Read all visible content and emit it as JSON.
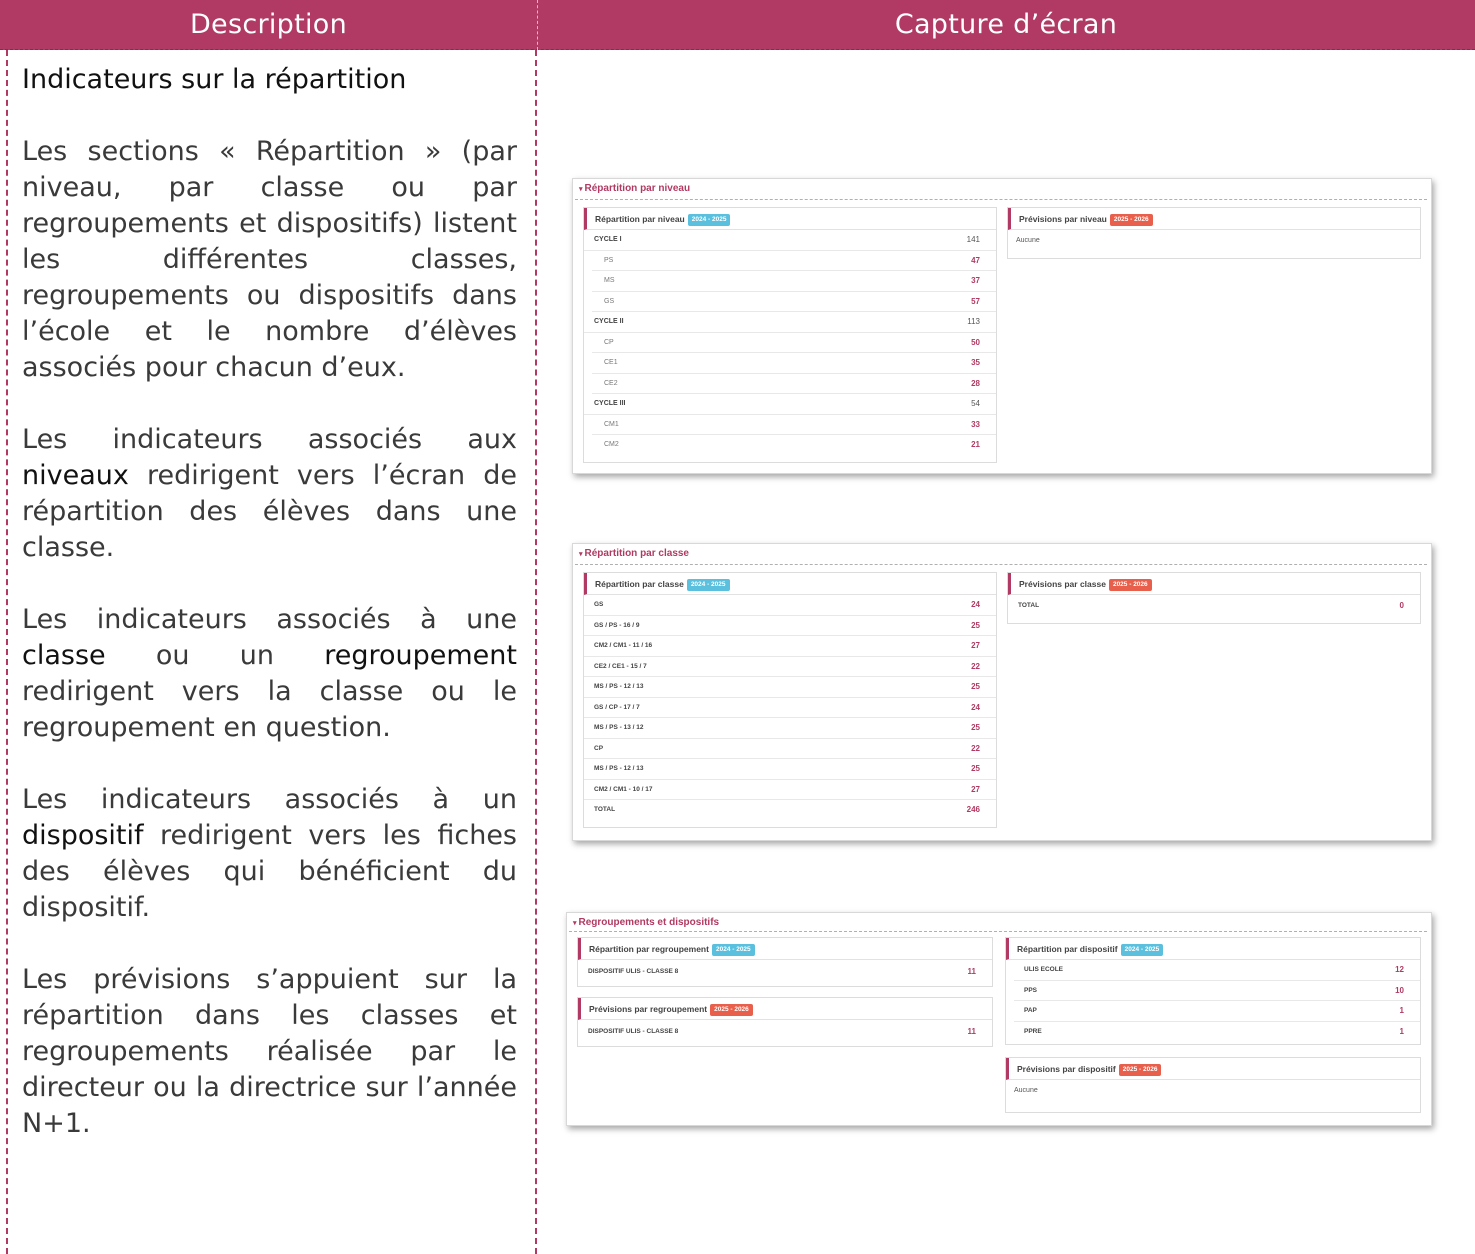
{
  "header": {
    "col_description": "Description",
    "col_capture": "Capture d’écran"
  },
  "description": {
    "title": "Indicateurs sur la répartition",
    "p1": "Les sections « Répartition » (par niveau, par classe ou par regroupements et dispositifs) listent les différentes classes, regroupements ou dispositifs dans l’école et le nombre d’élèves associés pour chacun d’eux.",
    "p2_a": "Les indicateurs associés aux ",
    "p2_kw": "niveaux",
    "p2_b": " redirigent vers l’écran de répartition des élèves dans une classe.",
    "p3_a": "Les indicateurs associés à une ",
    "p3_kw1": "classe",
    "p3_mid": " ou un ",
    "p3_kw2": "regroupement",
    "p3_b": " redirigent vers la classe ou le regroupement en question.",
    "p4_a": "Les indicateurs associés à un ",
    "p4_kw": "dispositif",
    "p4_b": " redirigent vers les fiches des élèves qui bénéficient du dispositif.",
    "p5": "Les prévisions s’appuient sur la répartition dans les classes et regroupements réalisée par le directeur ou la directrice sur l’année N+1."
  },
  "screens": {
    "niveau": {
      "section_title": "Répartition par niveau",
      "left_title": "Répartition par niveau",
      "left_badge": "2024 - 2025",
      "rows": [
        {
          "label": "CYCLE I",
          "value": "141",
          "kind": "cyc"
        },
        {
          "label": "PS",
          "value": "47",
          "kind": "sub"
        },
        {
          "label": "MS",
          "value": "37",
          "kind": "sub"
        },
        {
          "label": "GS",
          "value": "57",
          "kind": "sub"
        },
        {
          "label": "CYCLE II",
          "value": "113",
          "kind": "cyc"
        },
        {
          "label": "CP",
          "value": "50",
          "kind": "sub"
        },
        {
          "label": "CE1",
          "value": "35",
          "kind": "sub"
        },
        {
          "label": "CE2",
          "value": "28",
          "kind": "sub"
        },
        {
          "label": "CYCLE III",
          "value": "54",
          "kind": "cyc"
        },
        {
          "label": "CM1",
          "value": "33",
          "kind": "sub"
        },
        {
          "label": "CM2",
          "value": "21",
          "kind": "sub"
        }
      ],
      "right_title": "Prévisions par niveau",
      "right_badge": "2025 - 2026",
      "right_empty": "Aucune"
    },
    "classe": {
      "section_title": "Répartition par classe",
      "left_title": "Répartition par classe",
      "left_badge": "2024 - 2025",
      "rows": [
        {
          "label": "GS",
          "value": "24"
        },
        {
          "label": "GS / PS - 16 / 9",
          "value": "25"
        },
        {
          "label": "CM2 / CM1 - 11 / 16",
          "value": "27"
        },
        {
          "label": "CE2 / CE1 - 15 / 7",
          "value": "22"
        },
        {
          "label": "MS / PS - 12 / 13",
          "value": "25"
        },
        {
          "label": "GS / CP - 17 / 7",
          "value": "24"
        },
        {
          "label": "MS / PS - 13 / 12",
          "value": "25"
        },
        {
          "label": "CP",
          "value": "22"
        },
        {
          "label": "MS / PS - 12 / 13",
          "value": "25"
        },
        {
          "label": "CM2 / CM1 - 10 / 17",
          "value": "27"
        },
        {
          "label": "TOTAL",
          "value": "246"
        }
      ],
      "right_title": "Prévisions par classe",
      "right_badge": "2025 - 2026",
      "right_rows": [
        {
          "label": "TOTAL",
          "value": "0"
        }
      ]
    },
    "regroup": {
      "section_title": "Regroupements et dispositifs",
      "reg_title": "Répartition par regroupement",
      "reg_badge": "2024 - 2025",
      "reg_rows": [
        {
          "label": "DISPOSITIF ULIS - CLASSE 8",
          "value": "11"
        }
      ],
      "prev_reg_title": "Prévisions par regroupement",
      "prev_reg_badge": "2025 - 2026",
      "prev_reg_rows": [
        {
          "label": "DISPOSITIF ULIS - CLASSE 8",
          "value": "11"
        }
      ],
      "disp_title": "Répartition par dispositif",
      "disp_badge": "2024 - 2025",
      "disp_rows": [
        {
          "label": "ULIS ECOLE",
          "value": "12"
        },
        {
          "label": "PPS",
          "value": "10"
        },
        {
          "label": "PAP",
          "value": "1"
        },
        {
          "label": "PPRE",
          "value": "1"
        }
      ],
      "prev_disp_title": "Prévisions par dispositif",
      "prev_disp_badge": "2025 - 2026",
      "prev_disp_empty": "Aucune"
    }
  }
}
